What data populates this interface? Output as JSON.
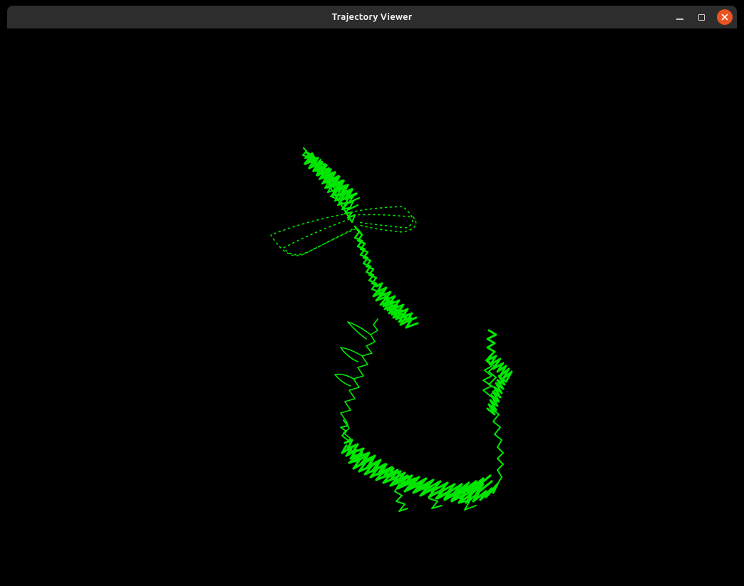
{
  "window": {
    "title": "Trajectory Viewer"
  },
  "colors": {
    "trajectory": "#00e600",
    "close_button": "#e95420",
    "titlebar_bg": "#2d2d2d",
    "canvas_bg": "#000000"
  },
  "icons": {
    "minimize": "minimize-icon",
    "maximize": "maximize-icon",
    "close": "close-icon"
  }
}
